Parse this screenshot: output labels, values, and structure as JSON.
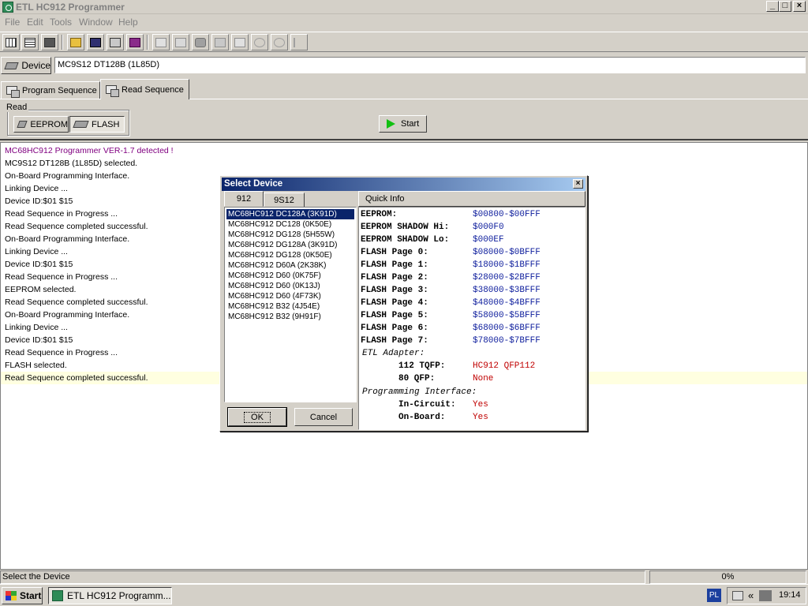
{
  "window": {
    "title": "ETL HC912 Programmer"
  },
  "menu": [
    "File",
    "Edit",
    "Tools",
    "Window",
    "Help"
  ],
  "toolbar_icons": [
    "grid-icon",
    "list-icon",
    "chip-icon",
    "folder-open-icon",
    "save-icon",
    "print-icon",
    "book-icon",
    "copy-icon",
    "paste-icon",
    "binoculars-icon",
    "calculator-icon",
    "table-icon",
    "undo-icon",
    "refresh-icon",
    "step-icon"
  ],
  "device": {
    "button_label": "Device",
    "selected": "MC9S12 DT128B (1L85D)"
  },
  "tabs": {
    "program": "Program Sequence",
    "read": "Read Sequence"
  },
  "read_panel": {
    "group_label": "Read",
    "eeprom": "EEPROM",
    "flash": "FLASH",
    "start": "Start"
  },
  "log": [
    {
      "text": "MC68HC912 Programmer VER-1.7 detected !",
      "color": "#800080"
    },
    {
      "text": "MC9S12 DT128B (1L85D) selected."
    },
    {
      "text": "On-Board Programming Interface."
    },
    {
      "text": "Linking Device ..."
    },
    {
      "text": "Device ID:$01 $15"
    },
    {
      "text": "Read Sequence in Progress ..."
    },
    {
      "text": "Read Sequence completed successful."
    },
    {
      "text": "On-Board Programming Interface."
    },
    {
      "text": "Linking Device ..."
    },
    {
      "text": "Device ID:$01 $15"
    },
    {
      "text": "Read Sequence in Progress ..."
    },
    {
      "text": "EEPROM selected."
    },
    {
      "text": "Read Sequence completed successful."
    },
    {
      "text": "On-Board Programming Interface."
    },
    {
      "text": "Linking Device ..."
    },
    {
      "text": "Device ID:$01 $15"
    },
    {
      "text": "Read Sequence in Progress ..."
    },
    {
      "text": "FLASH selected."
    },
    {
      "text": "Read Sequence completed successful."
    }
  ],
  "dialog": {
    "title": "Select Device",
    "tabs": [
      "912",
      "9S12"
    ],
    "quick_info_label": "Quick Info",
    "devices": [
      "MC68HC912 DC128A (3K91D)",
      "MC68HC912 DC128 (0K50E)",
      "MC68HC912 DG128 (5H55W)",
      "MC68HC912 DG128A (3K91D)",
      "MC68HC912 DG128 (0K50E)",
      "MC68HC912 D60A (2K38K)",
      "MC68HC912 D60 (0K75F)",
      "MC68HC912 D60 (0K13J)",
      "MC68HC912 D60 (4F73K)",
      "MC68HC912 B32 (4J54E)",
      "MC68HC912 B32 (9H91F)"
    ],
    "selected_index": 0,
    "quick_info": [
      {
        "key": "EEPROM:",
        "value": "$00800-$00FFF"
      },
      {
        "key": "EEPROM SHADOW Hi:",
        "value": "$000F0"
      },
      {
        "key": "EEPROM SHADOW Lo:",
        "value": "$000EF"
      },
      {
        "key": "FLASH Page 0:",
        "value": "$08000-$0BFFF"
      },
      {
        "key": "FLASH Page 1:",
        "value": "$18000-$1BFFF"
      },
      {
        "key": "FLASH Page 2:",
        "value": "$28000-$2BFFF"
      },
      {
        "key": "FLASH Page 3:",
        "value": "$38000-$3BFFF"
      },
      {
        "key": "FLASH Page 4:",
        "value": "$48000-$4BFFF"
      },
      {
        "key": "FLASH Page 5:",
        "value": "$58000-$5BFFF"
      },
      {
        "key": "FLASH Page 6:",
        "value": "$68000-$6BFFF"
      },
      {
        "key": "FLASH Page 7:",
        "value": "$78000-$7BFFF"
      }
    ],
    "adapter": {
      "heading": "ETL Adapter:",
      "tqfp_label": "112 TQFP:",
      "tqfp_value": "HC912 QFP112",
      "qfp_label": "80 QFP:",
      "qfp_value": "None"
    },
    "interface": {
      "heading": "Programming Interface:",
      "incircuit_label": "In-Circuit:",
      "incircuit_value": "Yes",
      "onboard_label": "On-Board:",
      "onboard_value": "Yes"
    },
    "ok": "OK",
    "cancel": "Cancel"
  },
  "status": {
    "text": "Select the Device",
    "progress": "0%"
  },
  "taskbar": {
    "start": "Start",
    "task": "ETL HC912 Programm...",
    "lang": "PL",
    "chevron": "«",
    "clock": "19:14"
  }
}
